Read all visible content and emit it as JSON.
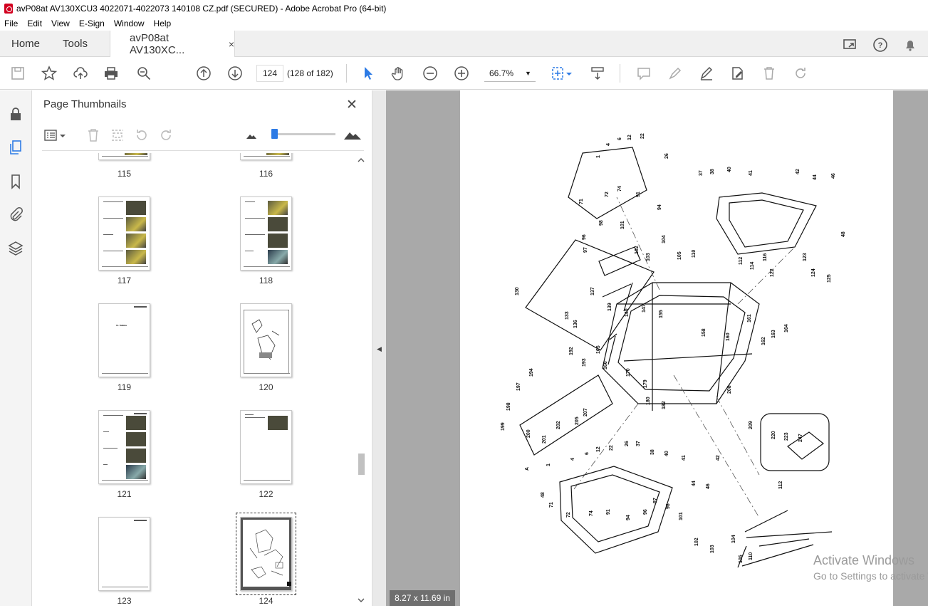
{
  "window": {
    "title": "avP08at AV130XCU3 4022071-4022073 140108 CZ.pdf (SECURED) - Adobe Acrobat Pro (64-bit)"
  },
  "menu": {
    "items": [
      "File",
      "Edit",
      "View",
      "E-Sign",
      "Window",
      "Help"
    ]
  },
  "tabs": {
    "home": "Home",
    "tools": "Tools",
    "doc": "avP08at AV130XC...",
    "close": "×"
  },
  "toolbar": {
    "page_number": "124",
    "page_of": "(128 of 182)",
    "zoom": "66.7%"
  },
  "panel": {
    "title": "Page Thumbnails",
    "close": "✕"
  },
  "thumbnails": [
    {
      "label": "115"
    },
    {
      "label": "116"
    },
    {
      "label": "117"
    },
    {
      "label": "118"
    },
    {
      "label": "119"
    },
    {
      "label": "120"
    },
    {
      "label": "121"
    },
    {
      "label": "122"
    },
    {
      "label": "123"
    },
    {
      "label": "124"
    }
  ],
  "thumb119_heading": "11. Kabina",
  "viewer": {
    "page_size": "8.27 x 11.69 in",
    "watermark_line1": "Activate Windows",
    "watermark_line2": "Go to Settings to activate Windows."
  },
  "diagram_labels": [
    "1",
    "4",
    "6",
    "12",
    "22",
    "26",
    "37",
    "38",
    "40",
    "41",
    "42",
    "44",
    "46",
    "48",
    "71",
    "72",
    "74",
    "91",
    "94",
    "96",
    "97",
    "98",
    "101",
    "102",
    "103",
    "104",
    "105",
    "110",
    "112",
    "114",
    "116",
    "122",
    "123",
    "124",
    "125",
    "130",
    "133",
    "136",
    "137",
    "139",
    "140",
    "147",
    "155",
    "158",
    "160",
    "161",
    "162",
    "163",
    "164",
    "165",
    "166",
    "170",
    "179",
    "180",
    "182",
    "192",
    "193",
    "194",
    "197",
    "198",
    "199",
    "200",
    "201",
    "202",
    "205",
    "207",
    "208",
    "209",
    "220",
    "223",
    "247",
    "A"
  ],
  "colors": {
    "accent": "#2d7be5",
    "pdf_red": "#d2001f"
  }
}
